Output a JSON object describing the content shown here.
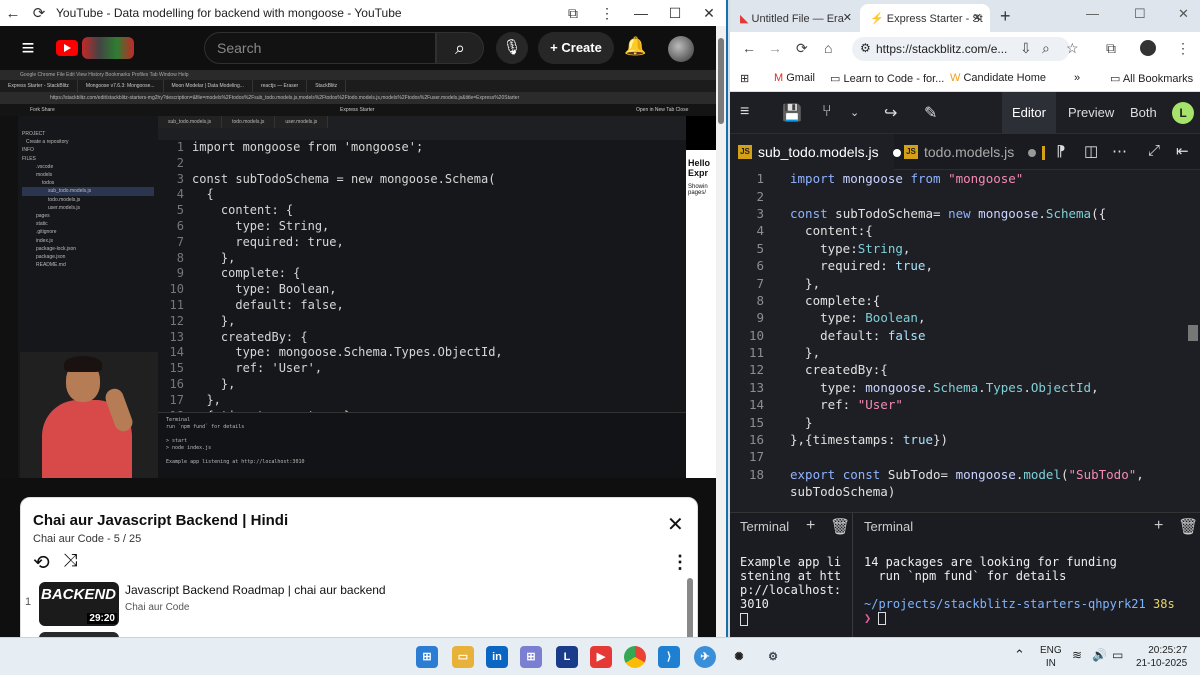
{
  "left_window": {
    "title": "YouTube - Data modelling for backend with mongoose - YouTube",
    "search_placeholder": "Search",
    "create_label": "Create",
    "video": {
      "chrome_menu": "Google Chrome   File   Edit   View   History   Bookmarks   Profiles   Tab   Window   Help",
      "tabs": [
        "Express Starter - StackBlitz",
        "Mongoose v7.6.3: Mongoose...",
        "Moon Modelar | Data Modeling...",
        "reactjs — Eraser",
        "StackBlitz"
      ],
      "address": "https://stackblitz.com/edit/stackblitz-starters-mg2hy?description=&file=models%2Ftodos%2Fsub_todo.models.js,models%2Ftodos%2Ftodo.models.js,models%2Ftodos%2Fuser.models.js&title=Express%20Starter",
      "toolbar_left": "Fork    Share",
      "toolbar_center": "Express Starter",
      "toolbar_right": "Open in New Tab     Close",
      "file_tabs": [
        "sub_todo.models.js",
        "todo.models.js",
        "user.models.js"
      ],
      "tree": [
        "PROJECT",
        "Create a repository",
        "INFO",
        "FILES",
        ".vscode",
        "models",
        "todos",
        "sub_todo.models.js",
        "todo.models.js",
        "user.models.js",
        "pages",
        "static",
        ".gitignore",
        "index.js",
        "package-lock.json",
        "package.json",
        "README.md"
      ],
      "code_lines": [
        {
          "n": "1",
          "t": "import mongoose from 'mongoose';"
        },
        {
          "n": "2",
          "t": ""
        },
        {
          "n": "3",
          "t": "const subTodoSchema = new mongoose.Schema("
        },
        {
          "n": "4",
          "t": "  {"
        },
        {
          "n": "5",
          "t": "    content: {"
        },
        {
          "n": "6",
          "t": "      type: String,"
        },
        {
          "n": "7",
          "t": "      required: true,"
        },
        {
          "n": "8",
          "t": "    },"
        },
        {
          "n": "9",
          "t": "    complete: {"
        },
        {
          "n": "10",
          "t": "      type: Boolean,"
        },
        {
          "n": "11",
          "t": "      default: false,"
        },
        {
          "n": "12",
          "t": "    },"
        },
        {
          "n": "13",
          "t": "    createdBy: {"
        },
        {
          "n": "14",
          "t": "      type: mongoose.Schema.Types.ObjectId,"
        },
        {
          "n": "15",
          "t": "      ref: 'User',"
        },
        {
          "n": "16",
          "t": "    },"
        },
        {
          "n": "17",
          "t": "  },"
        },
        {
          "n": "18",
          "t": "  { timestamps: true }"
        }
      ],
      "terminal": [
        "Terminal",
        "  run `npm fund` for details",
        "",
        "> start",
        "> node index.js",
        "",
        "Example app listening at http://localhost:3010"
      ],
      "preview_text": "Hello Expr",
      "preview_sub": "Showin pages/"
    },
    "playlist": {
      "title": "Chai aur Javascript Backend | Hindi",
      "subtitle": "Chai aur Code - 5 / 25",
      "items": [
        {
          "index": "1",
          "thumb_text": "BACKEND",
          "duration": "29:20",
          "title": "Javascript Backend Roadmap | chai aur backend",
          "channel": "Chai aur Code"
        }
      ]
    }
  },
  "right_window": {
    "tabs": [
      {
        "label": "Untitled File — Era"
      },
      {
        "label": "Express Starter - St"
      }
    ],
    "url": "https://stackblitz.com/e...",
    "bookmarks": [
      "Gmail",
      "Learn to Code - for...",
      "Candidate Home",
      "All Bookmarks"
    ],
    "toolbar": {
      "editor": "Editor",
      "preview": "Preview",
      "both": "Both",
      "avatar": "L"
    },
    "file_tabs": [
      {
        "label": "sub_todo.models.js"
      },
      {
        "label": "todo.models.js"
      }
    ],
    "code_lines": [
      {
        "n": "1",
        "t": "import mongoose from \"mongoose\""
      },
      {
        "n": "2",
        "t": ""
      },
      {
        "n": "3",
        "t": "const subTodoSchema= new mongoose.Schema({"
      },
      {
        "n": "4",
        "t": "  content:{"
      },
      {
        "n": "5",
        "t": "    type:String,"
      },
      {
        "n": "6",
        "t": "    required: true,"
      },
      {
        "n": "7",
        "t": "  },"
      },
      {
        "n": "8",
        "t": "  complete:{"
      },
      {
        "n": "9",
        "t": "    type: Boolean,"
      },
      {
        "n": "10",
        "t": "    default: false"
      },
      {
        "n": "11",
        "t": "  },"
      },
      {
        "n": "12",
        "t": "  createdBy:{"
      },
      {
        "n": "13",
        "t": "    type: mongoose.Schema.Types.ObjectId,"
      },
      {
        "n": "14",
        "t": "    ref: \"User\""
      },
      {
        "n": "15",
        "t": "  }"
      },
      {
        "n": "16",
        "t": "},{timestamps: true})"
      },
      {
        "n": "17",
        "t": ""
      },
      {
        "n": "18",
        "t": "export const SubTodo= mongoose.model(\"SubTodo\","
      },
      {
        "n": "",
        "t": "subTodoSchema)"
      }
    ],
    "terminal_left": {
      "title": "Terminal",
      "output": "Example app li\nstening at htt\np://localhost:\n3010"
    },
    "terminal_right": {
      "title": "Terminal",
      "line1": "14 packages are looking for funding",
      "line2": "  run `npm fund` for details",
      "path": "~/projects/stackblitz-starters-qhpyrk21",
      "time": "38s",
      "prompt": "❯"
    }
  },
  "taskbar": {
    "lang": "ENG",
    "region": "IN",
    "time": "20:25:27",
    "date": "21-10-2025"
  },
  "colors": {
    "accent": "#1b6fa8",
    "yt_red": "#ff0000",
    "js_badge": "#d4a017",
    "avatar_green": "#a6e36b"
  }
}
